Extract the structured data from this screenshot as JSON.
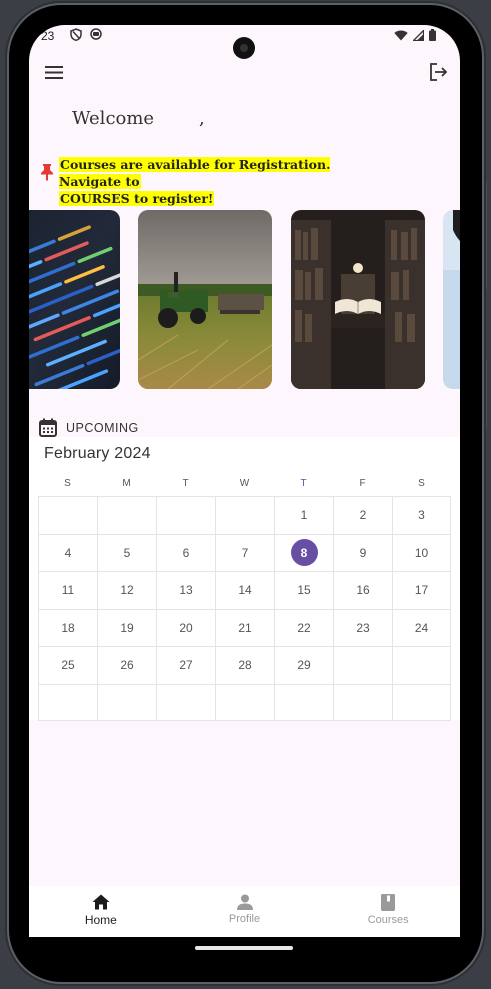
{
  "status_bar": {
    "time": "23"
  },
  "greeting": {
    "welcome": "Welcome",
    "comma": ","
  },
  "notice": {
    "text_line1": "Courses are available for Registration. Navigate to",
    "text_line2": "COURSES to register!"
  },
  "carousel": [
    {
      "name": "code-screen-image"
    },
    {
      "name": "tractor-field-image"
    },
    {
      "name": "library-book-image"
    },
    {
      "name": "partial-image"
    }
  ],
  "upcoming": {
    "label": "UPCOMING"
  },
  "calendar": {
    "month": "February 2024",
    "weekdays": [
      "S",
      "M",
      "T",
      "W",
      "T",
      "F",
      "S"
    ],
    "today_weekday_index": 4,
    "selected_day": "8",
    "weeks": [
      [
        "",
        "",
        "",
        "",
        "1",
        "2",
        "3"
      ],
      [
        "4",
        "5",
        "6",
        "7",
        "8",
        "9",
        "10"
      ],
      [
        "11",
        "12",
        "13",
        "14",
        "15",
        "16",
        "17"
      ],
      [
        "18",
        "19",
        "20",
        "21",
        "22",
        "23",
        "24"
      ],
      [
        "25",
        "26",
        "27",
        "28",
        "29",
        "",
        ""
      ],
      [
        "",
        "",
        "",
        "",
        "",
        "",
        ""
      ]
    ]
  },
  "bottom_nav": [
    {
      "label": "Home",
      "icon": "home-icon",
      "active": true
    },
    {
      "label": "Profile",
      "icon": "person-icon",
      "active": false
    },
    {
      "label": "Courses",
      "icon": "book-icon",
      "active": false
    }
  ],
  "colors": {
    "accent": "#6750a4",
    "highlight": "#ffff00",
    "pin": "#e53935",
    "background": "#fdf7fd"
  }
}
